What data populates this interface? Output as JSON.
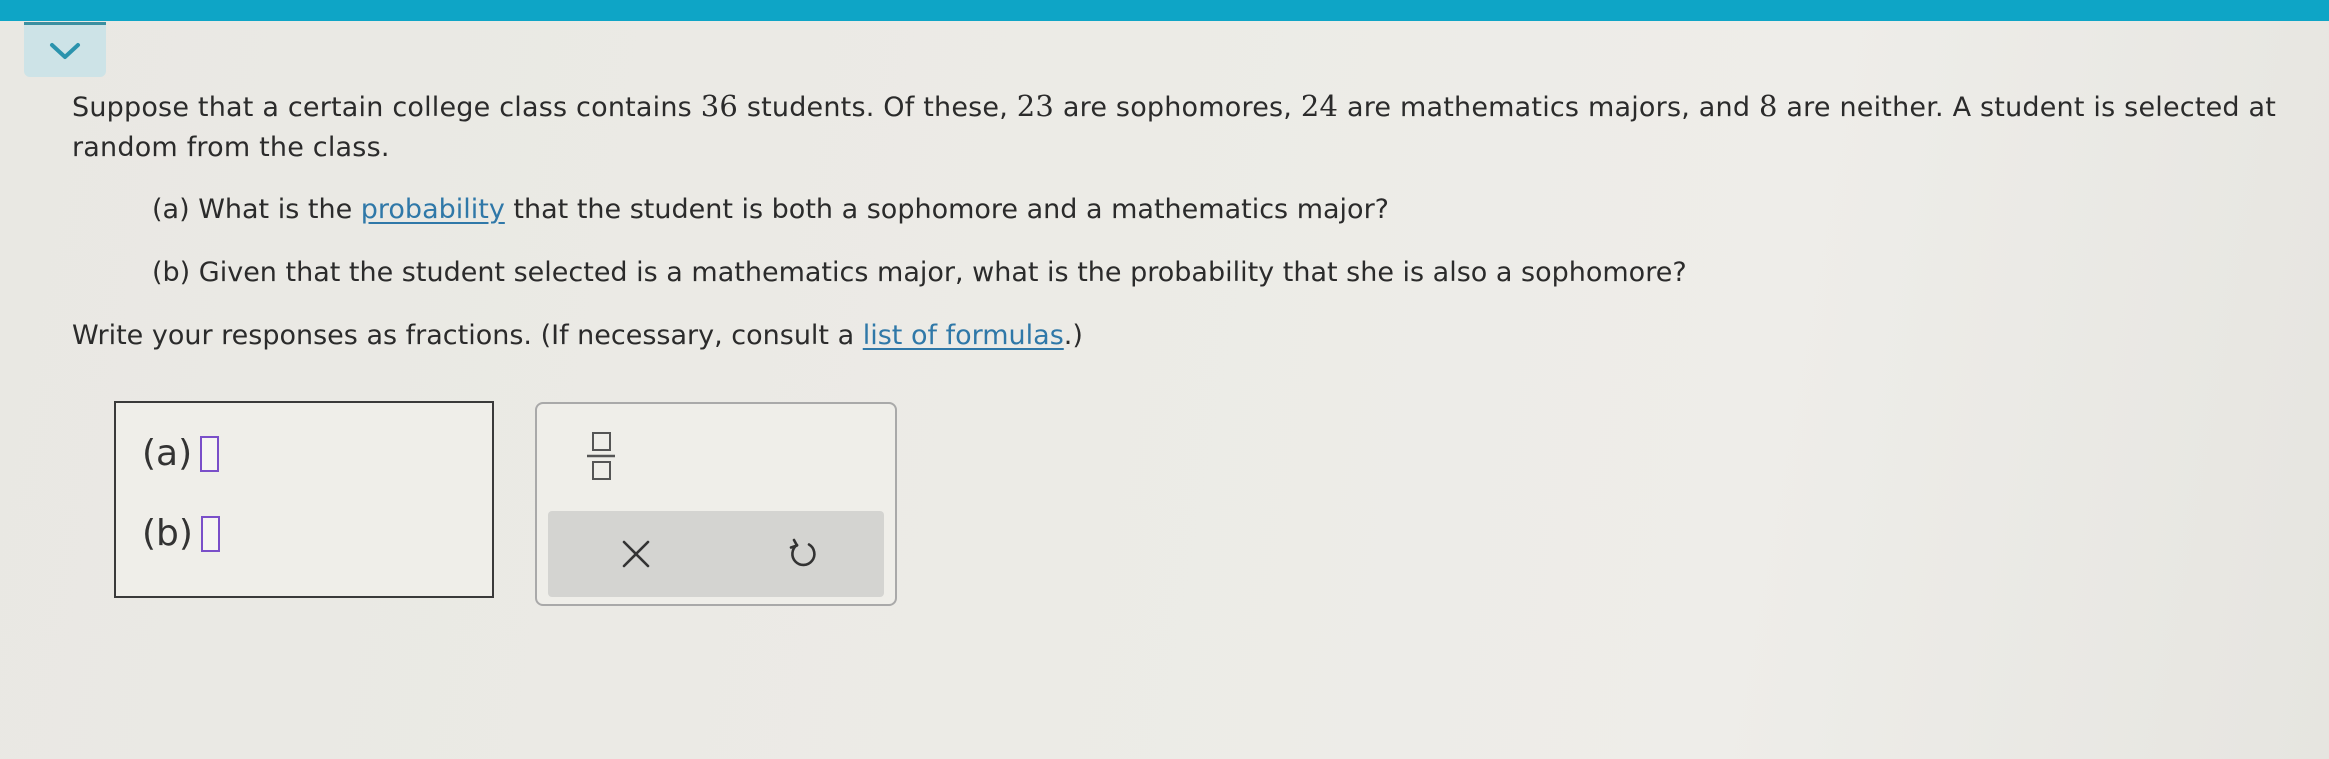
{
  "header": {
    "collapse_icon": "chevron-down-icon",
    "accent_color": "#0ea5c6"
  },
  "question": {
    "intro_1": "Suppose that a certain college class contains ",
    "total_students": "36",
    "intro_2": " students. Of these, ",
    "sophomores": "23",
    "intro_3": " are sophomores, ",
    "math_majors": "24",
    "intro_4": " are mathematics majors, and ",
    "neither": "8",
    "intro_5": " are neither. A student is selected at random from the class.",
    "part_a_prefix": "(a) What is the ",
    "part_a_link": "probability",
    "part_a_suffix": " that the student is both a sophomore and a mathematics major?",
    "part_b": "(b) Given that the student selected is a mathematics major, what is the probability that she is also a sophomore?",
    "instructions_prefix": "Write your responses as fractions. (If necessary, consult a ",
    "instructions_link": "list of formulas",
    "instructions_suffix": ".)"
  },
  "answers": {
    "a_label": "(a)",
    "a_value": "",
    "b_label": "(b)",
    "b_value": "",
    "slot_color": "#7a4fc9"
  },
  "palette": {
    "fraction_icon": "fraction-icon",
    "clear_icon": "close-icon",
    "undo_icon": "undo-icon"
  }
}
